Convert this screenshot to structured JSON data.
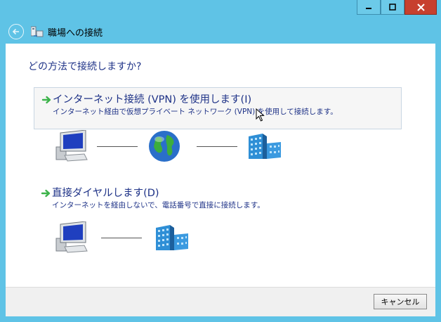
{
  "window": {
    "title": "職場への接続",
    "controls": [
      "minimize-icon",
      "maximize-icon",
      "close-icon"
    ]
  },
  "question": "どの方法で接続しますか?",
  "options": [
    {
      "title": "インターネット接続 (VPN) を使用します(I)",
      "description": "インターネット経由で仮想プライベート ネットワーク (VPN) を使用して接続します。",
      "icon": "green-arrow-icon",
      "diagram": [
        "computer-icon",
        "globe-icon",
        "office-building-icon"
      ]
    },
    {
      "title": "直接ダイヤルします(D)",
      "description": "インターネットを経由しないで、電話番号で直接に接続します。",
      "icon": "green-arrow-icon",
      "diagram": [
        "computer-icon",
        "office-building-icon"
      ]
    }
  ],
  "footer": {
    "cancel_label": "キャンセル"
  },
  "colors": {
    "window_frame": "#5fc3e6",
    "accent_text": "#1e3287",
    "arrow_green": "#3cb34a",
    "close_button": "#c7402e"
  }
}
